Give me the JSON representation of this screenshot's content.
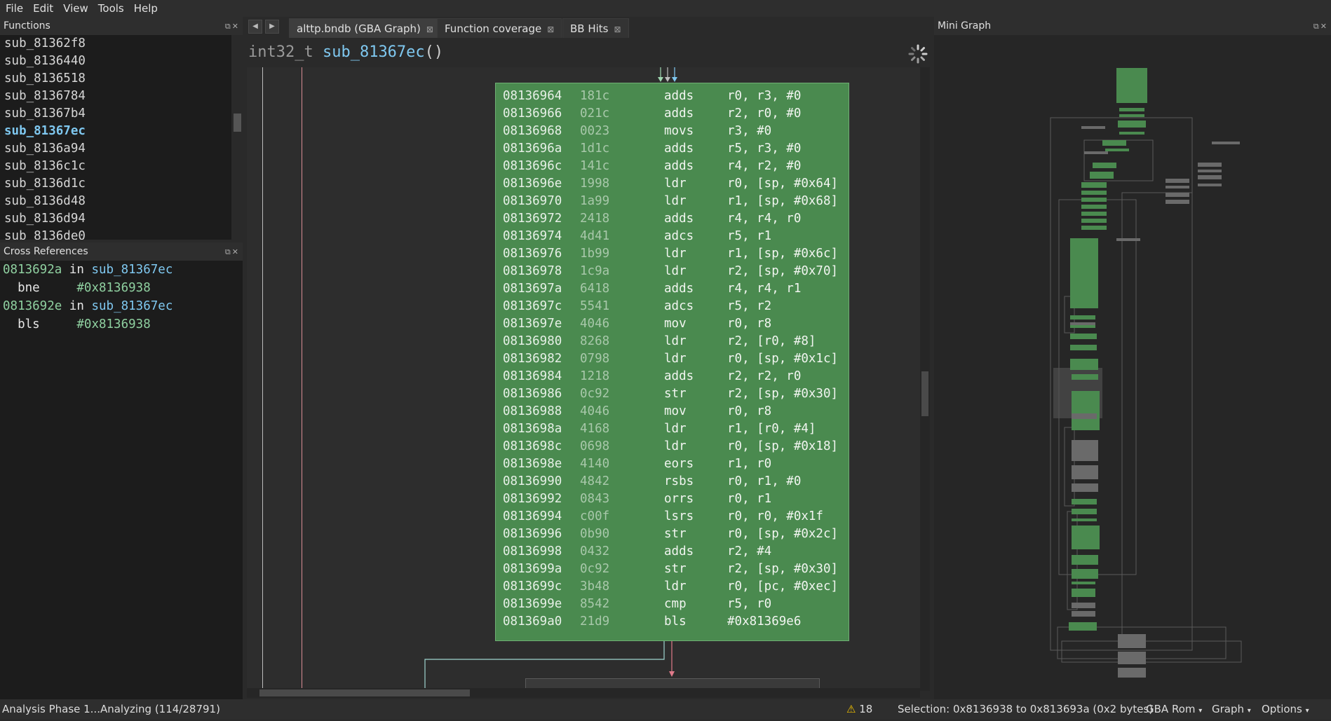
{
  "menu": [
    "File",
    "Edit",
    "View",
    "Tools",
    "Help"
  ],
  "functions_panel": {
    "title": "Functions",
    "items": [
      "sub_81362f8",
      "sub_8136440",
      "sub_8136518",
      "sub_8136784",
      "sub_81367b4",
      "sub_81367ec",
      "sub_8136a94",
      "sub_8136c1c",
      "sub_8136d1c",
      "sub_8136d48",
      "sub_8136d94",
      "sub_8136de0"
    ],
    "active_index": 5
  },
  "xrefs_panel": {
    "title": "Cross References",
    "entries": [
      {
        "addr": "0813692a",
        "in": "in",
        "func": "sub_81367ec",
        "mnemonic": "bne",
        "target": "#0x8136938"
      },
      {
        "addr": "0813692e",
        "in": "in",
        "func": "sub_81367ec",
        "mnemonic": "bls",
        "target": "#0x8136938"
      }
    ]
  },
  "tabs": [
    {
      "label": "alttp.bndb (GBA Graph)",
      "active": true
    },
    {
      "label": "Function coverage",
      "active": false
    },
    {
      "label": "BB Hits",
      "active": false
    }
  ],
  "function_header": {
    "return_type": "int32_t",
    "name": "sub_81367ec",
    "params": "()"
  },
  "block": {
    "instructions": [
      {
        "addr": "08136964",
        "bytes": "181c",
        "mnem": "adds",
        "ops": "r0, r3, #0"
      },
      {
        "addr": "08136966",
        "bytes": "021c",
        "mnem": "adds",
        "ops": "r2, r0, #0"
      },
      {
        "addr": "08136968",
        "bytes": "0023",
        "mnem": "movs",
        "ops": "r3, #0"
      },
      {
        "addr": "0813696a",
        "bytes": "1d1c",
        "mnem": "adds",
        "ops": "r5, r3, #0"
      },
      {
        "addr": "0813696c",
        "bytes": "141c",
        "mnem": "adds",
        "ops": "r4, r2, #0"
      },
      {
        "addr": "0813696e",
        "bytes": "1998",
        "mnem": "ldr",
        "ops": "r0, [sp, #0x64]"
      },
      {
        "addr": "08136970",
        "bytes": "1a99",
        "mnem": "ldr",
        "ops": "r1, [sp, #0x68]"
      },
      {
        "addr": "08136972",
        "bytes": "2418",
        "mnem": "adds",
        "ops": "r4, r4, r0"
      },
      {
        "addr": "08136974",
        "bytes": "4d41",
        "mnem": "adcs",
        "ops": "r5, r1"
      },
      {
        "addr": "08136976",
        "bytes": "1b99",
        "mnem": "ldr",
        "ops": "r1, [sp, #0x6c]"
      },
      {
        "addr": "08136978",
        "bytes": "1c9a",
        "mnem": "ldr",
        "ops": "r2, [sp, #0x70]"
      },
      {
        "addr": "0813697a",
        "bytes": "6418",
        "mnem": "adds",
        "ops": "r4, r4, r1"
      },
      {
        "addr": "0813697c",
        "bytes": "5541",
        "mnem": "adcs",
        "ops": "r5, r2"
      },
      {
        "addr": "0813697e",
        "bytes": "4046",
        "mnem": "mov",
        "ops": "r0, r8"
      },
      {
        "addr": "08136980",
        "bytes": "8268",
        "mnem": "ldr",
        "ops": "r2, [r0, #8]"
      },
      {
        "addr": "08136982",
        "bytes": "0798",
        "mnem": "ldr",
        "ops": "r0, [sp, #0x1c]"
      },
      {
        "addr": "08136984",
        "bytes": "1218",
        "mnem": "adds",
        "ops": "r2, r2, r0"
      },
      {
        "addr": "08136986",
        "bytes": "0c92",
        "mnem": "str",
        "ops": "r2, [sp, #0x30]"
      },
      {
        "addr": "08136988",
        "bytes": "4046",
        "mnem": "mov",
        "ops": "r0, r8"
      },
      {
        "addr": "0813698a",
        "bytes": "4168",
        "mnem": "ldr",
        "ops": "r1, [r0, #4]"
      },
      {
        "addr": "0813698c",
        "bytes": "0698",
        "mnem": "ldr",
        "ops": "r0, [sp, #0x18]"
      },
      {
        "addr": "0813698e",
        "bytes": "4140",
        "mnem": "eors",
        "ops": "r1, r0"
      },
      {
        "addr": "08136990",
        "bytes": "4842",
        "mnem": "rsbs",
        "ops": "r0, r1, #0"
      },
      {
        "addr": "08136992",
        "bytes": "0843",
        "mnem": "orrs",
        "ops": "r0, r1"
      },
      {
        "addr": "08136994",
        "bytes": "c00f",
        "mnem": "lsrs",
        "ops": "r0, r0, #0x1f"
      },
      {
        "addr": "08136996",
        "bytes": "0b90",
        "mnem": "str",
        "ops": "r0, [sp, #0x2c]"
      },
      {
        "addr": "08136998",
        "bytes": "0432",
        "mnem": "adds",
        "ops": "r2, #4"
      },
      {
        "addr": "0813699a",
        "bytes": "0c92",
        "mnem": "str",
        "ops": "r2, [sp, #0x30]"
      },
      {
        "addr": "0813699c",
        "bytes": "3b48",
        "mnem": "ldr",
        "ops": "r0, [pc, #0xec]"
      },
      {
        "addr": "0813699e",
        "bytes": "8542",
        "mnem": "cmp",
        "ops": "r5, r0"
      },
      {
        "addr": "081369a0",
        "bytes": "21d9",
        "mnem": "bls",
        "ops": "#0x81369e6"
      }
    ]
  },
  "mini_graph": {
    "title": "Mini Graph"
  },
  "status": {
    "analysis": "Analysis Phase 1...Analyzing (114/28791)",
    "warning_count": "18",
    "selection": "Selection: 0x8136938 to 0x813693a (0x2 bytes)",
    "platform": "GBA Rom",
    "view": "Graph",
    "options": "Options"
  },
  "colors": {
    "block_green": "#4a8a4f",
    "accent_blue": "#7fc8f0",
    "addr_green": "#8fd0a0"
  }
}
